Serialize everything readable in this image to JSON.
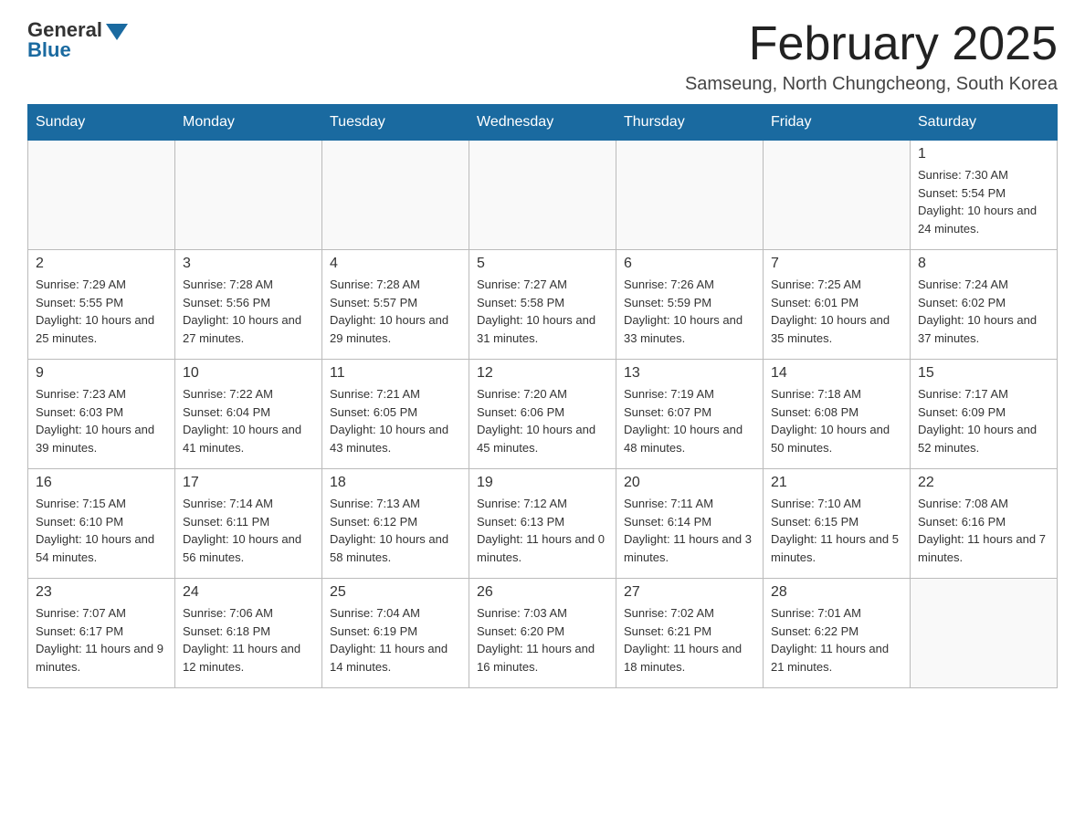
{
  "logo": {
    "general_text": "General",
    "blue_text": "Blue"
  },
  "title": "February 2025",
  "location": "Samseung, North Chungcheong, South Korea",
  "weekdays": [
    "Sunday",
    "Monday",
    "Tuesday",
    "Wednesday",
    "Thursday",
    "Friday",
    "Saturday"
  ],
  "weeks": [
    [
      {
        "day": "",
        "sunrise": "",
        "sunset": "",
        "daylight": ""
      },
      {
        "day": "",
        "sunrise": "",
        "sunset": "",
        "daylight": ""
      },
      {
        "day": "",
        "sunrise": "",
        "sunset": "",
        "daylight": ""
      },
      {
        "day": "",
        "sunrise": "",
        "sunset": "",
        "daylight": ""
      },
      {
        "day": "",
        "sunrise": "",
        "sunset": "",
        "daylight": ""
      },
      {
        "day": "",
        "sunrise": "",
        "sunset": "",
        "daylight": ""
      },
      {
        "day": "1",
        "sunrise": "Sunrise: 7:30 AM",
        "sunset": "Sunset: 5:54 PM",
        "daylight": "Daylight: 10 hours and 24 minutes."
      }
    ],
    [
      {
        "day": "2",
        "sunrise": "Sunrise: 7:29 AM",
        "sunset": "Sunset: 5:55 PM",
        "daylight": "Daylight: 10 hours and 25 minutes."
      },
      {
        "day": "3",
        "sunrise": "Sunrise: 7:28 AM",
        "sunset": "Sunset: 5:56 PM",
        "daylight": "Daylight: 10 hours and 27 minutes."
      },
      {
        "day": "4",
        "sunrise": "Sunrise: 7:28 AM",
        "sunset": "Sunset: 5:57 PM",
        "daylight": "Daylight: 10 hours and 29 minutes."
      },
      {
        "day": "5",
        "sunrise": "Sunrise: 7:27 AM",
        "sunset": "Sunset: 5:58 PM",
        "daylight": "Daylight: 10 hours and 31 minutes."
      },
      {
        "day": "6",
        "sunrise": "Sunrise: 7:26 AM",
        "sunset": "Sunset: 5:59 PM",
        "daylight": "Daylight: 10 hours and 33 minutes."
      },
      {
        "day": "7",
        "sunrise": "Sunrise: 7:25 AM",
        "sunset": "Sunset: 6:01 PM",
        "daylight": "Daylight: 10 hours and 35 minutes."
      },
      {
        "day": "8",
        "sunrise": "Sunrise: 7:24 AM",
        "sunset": "Sunset: 6:02 PM",
        "daylight": "Daylight: 10 hours and 37 minutes."
      }
    ],
    [
      {
        "day": "9",
        "sunrise": "Sunrise: 7:23 AM",
        "sunset": "Sunset: 6:03 PM",
        "daylight": "Daylight: 10 hours and 39 minutes."
      },
      {
        "day": "10",
        "sunrise": "Sunrise: 7:22 AM",
        "sunset": "Sunset: 6:04 PM",
        "daylight": "Daylight: 10 hours and 41 minutes."
      },
      {
        "day": "11",
        "sunrise": "Sunrise: 7:21 AM",
        "sunset": "Sunset: 6:05 PM",
        "daylight": "Daylight: 10 hours and 43 minutes."
      },
      {
        "day": "12",
        "sunrise": "Sunrise: 7:20 AM",
        "sunset": "Sunset: 6:06 PM",
        "daylight": "Daylight: 10 hours and 45 minutes."
      },
      {
        "day": "13",
        "sunrise": "Sunrise: 7:19 AM",
        "sunset": "Sunset: 6:07 PM",
        "daylight": "Daylight: 10 hours and 48 minutes."
      },
      {
        "day": "14",
        "sunrise": "Sunrise: 7:18 AM",
        "sunset": "Sunset: 6:08 PM",
        "daylight": "Daylight: 10 hours and 50 minutes."
      },
      {
        "day": "15",
        "sunrise": "Sunrise: 7:17 AM",
        "sunset": "Sunset: 6:09 PM",
        "daylight": "Daylight: 10 hours and 52 minutes."
      }
    ],
    [
      {
        "day": "16",
        "sunrise": "Sunrise: 7:15 AM",
        "sunset": "Sunset: 6:10 PM",
        "daylight": "Daylight: 10 hours and 54 minutes."
      },
      {
        "day": "17",
        "sunrise": "Sunrise: 7:14 AM",
        "sunset": "Sunset: 6:11 PM",
        "daylight": "Daylight: 10 hours and 56 minutes."
      },
      {
        "day": "18",
        "sunrise": "Sunrise: 7:13 AM",
        "sunset": "Sunset: 6:12 PM",
        "daylight": "Daylight: 10 hours and 58 minutes."
      },
      {
        "day": "19",
        "sunrise": "Sunrise: 7:12 AM",
        "sunset": "Sunset: 6:13 PM",
        "daylight": "Daylight: 11 hours and 0 minutes."
      },
      {
        "day": "20",
        "sunrise": "Sunrise: 7:11 AM",
        "sunset": "Sunset: 6:14 PM",
        "daylight": "Daylight: 11 hours and 3 minutes."
      },
      {
        "day": "21",
        "sunrise": "Sunrise: 7:10 AM",
        "sunset": "Sunset: 6:15 PM",
        "daylight": "Daylight: 11 hours and 5 minutes."
      },
      {
        "day": "22",
        "sunrise": "Sunrise: 7:08 AM",
        "sunset": "Sunset: 6:16 PM",
        "daylight": "Daylight: 11 hours and 7 minutes."
      }
    ],
    [
      {
        "day": "23",
        "sunrise": "Sunrise: 7:07 AM",
        "sunset": "Sunset: 6:17 PM",
        "daylight": "Daylight: 11 hours and 9 minutes."
      },
      {
        "day": "24",
        "sunrise": "Sunrise: 7:06 AM",
        "sunset": "Sunset: 6:18 PM",
        "daylight": "Daylight: 11 hours and 12 minutes."
      },
      {
        "day": "25",
        "sunrise": "Sunrise: 7:04 AM",
        "sunset": "Sunset: 6:19 PM",
        "daylight": "Daylight: 11 hours and 14 minutes."
      },
      {
        "day": "26",
        "sunrise": "Sunrise: 7:03 AM",
        "sunset": "Sunset: 6:20 PM",
        "daylight": "Daylight: 11 hours and 16 minutes."
      },
      {
        "day": "27",
        "sunrise": "Sunrise: 7:02 AM",
        "sunset": "Sunset: 6:21 PM",
        "daylight": "Daylight: 11 hours and 18 minutes."
      },
      {
        "day": "28",
        "sunrise": "Sunrise: 7:01 AM",
        "sunset": "Sunset: 6:22 PM",
        "daylight": "Daylight: 11 hours and 21 minutes."
      },
      {
        "day": "",
        "sunrise": "",
        "sunset": "",
        "daylight": ""
      }
    ]
  ]
}
